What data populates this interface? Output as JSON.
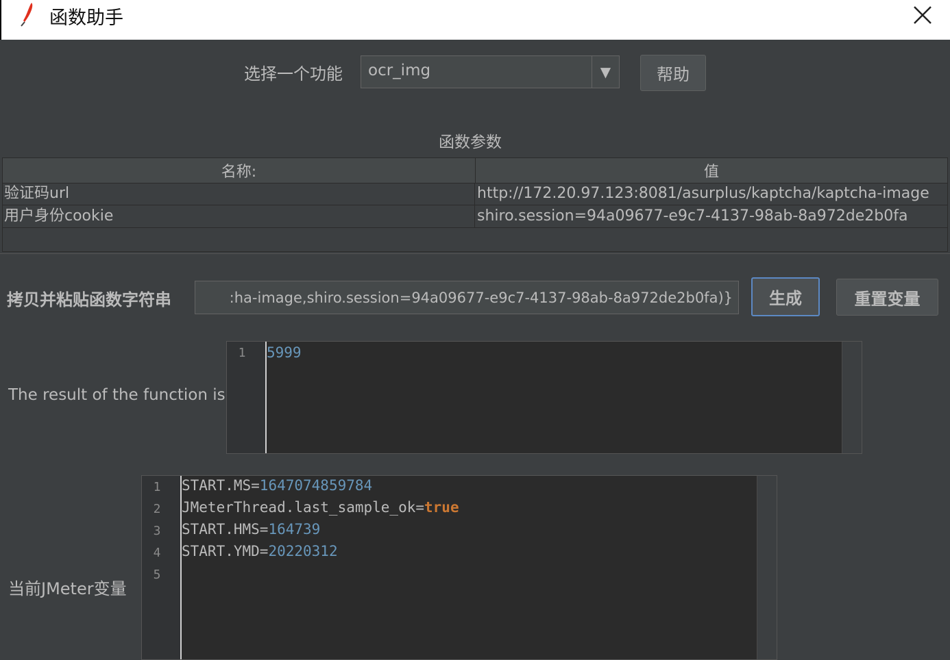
{
  "window": {
    "title": "函数助手"
  },
  "function_select": {
    "label": "选择一个功能",
    "value": "ocr_img",
    "help_label": "帮助"
  },
  "params": {
    "title": "函数参数",
    "columns": [
      "名称:",
      "值"
    ],
    "rows": [
      {
        "name": "验证码url",
        "value": "http://172.20.97.123:8081/asurplus/kaptcha/kaptcha-image"
      },
      {
        "name": "用户身份cookie",
        "value": "shiro.session=94a09677-e9c7-4137-98ab-8a972de2b0fa"
      }
    ]
  },
  "copy": {
    "label": "拷贝并粘贴函数字符串",
    "value": ":ha-image,shiro.session=94a09677-e9c7-4137-98ab-8a972de2b0fa)}",
    "generate_label": "生成",
    "reset_label": "重置变量"
  },
  "result": {
    "label": "The result of the function is",
    "lines": [
      {
        "n": "1",
        "text": "5999"
      }
    ]
  },
  "vars": {
    "label": "当前JMeter变量",
    "lines": [
      {
        "n": "1",
        "key": "START.MS=",
        "val": "1647074859784"
      },
      {
        "n": "2",
        "key": "JMeterThread.last_sample_ok=",
        "val": "true"
      },
      {
        "n": "3",
        "key": "START.HMS=",
        "val": "164739"
      },
      {
        "n": "4",
        "key": "START.YMD=",
        "val": "20220312"
      },
      {
        "n": "5",
        "key": "",
        "val": ""
      }
    ]
  },
  "colors": {
    "background": "#3c3f41",
    "number": "#6897bb",
    "keyword": "#cc7832",
    "focus": "#5c89c4"
  }
}
